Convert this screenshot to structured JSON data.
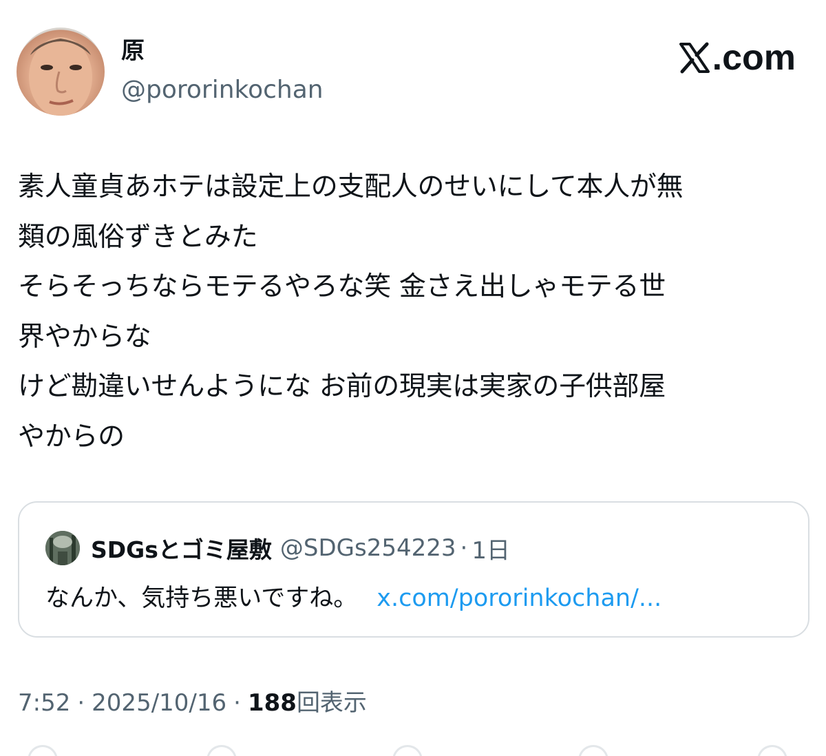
{
  "author": {
    "display_name": "原",
    "handle": "@pororinkochan"
  },
  "brand": {
    "text": ".com"
  },
  "tweet": {
    "lines": [
      "素人童貞あホテは設定上の支配人のせいにして本人が無",
      "類の風俗ずきとみた",
      "そらそっちならモテるやろな笑 金さえ出しゃモテる世",
      "界やからな",
      "けど勘違いせんようにな お前の現実は実家の子供部屋",
      "やからの"
    ]
  },
  "quote": {
    "name": "SDGsとゴミ屋敷",
    "handle": "@SDGs254223",
    "separator": "·",
    "time": "1日",
    "text": "なんか、気持ち悪いですね。",
    "link": "x.com/pororinkochan/..."
  },
  "meta": {
    "time": "7:52",
    "date": "2025/10/16",
    "separator": "·",
    "views": "188",
    "views_label": "回表示"
  },
  "colors": {
    "text": "#0f1419",
    "secondary": "#536471",
    "link": "#1d9bf0",
    "border": "#d9dee2"
  }
}
